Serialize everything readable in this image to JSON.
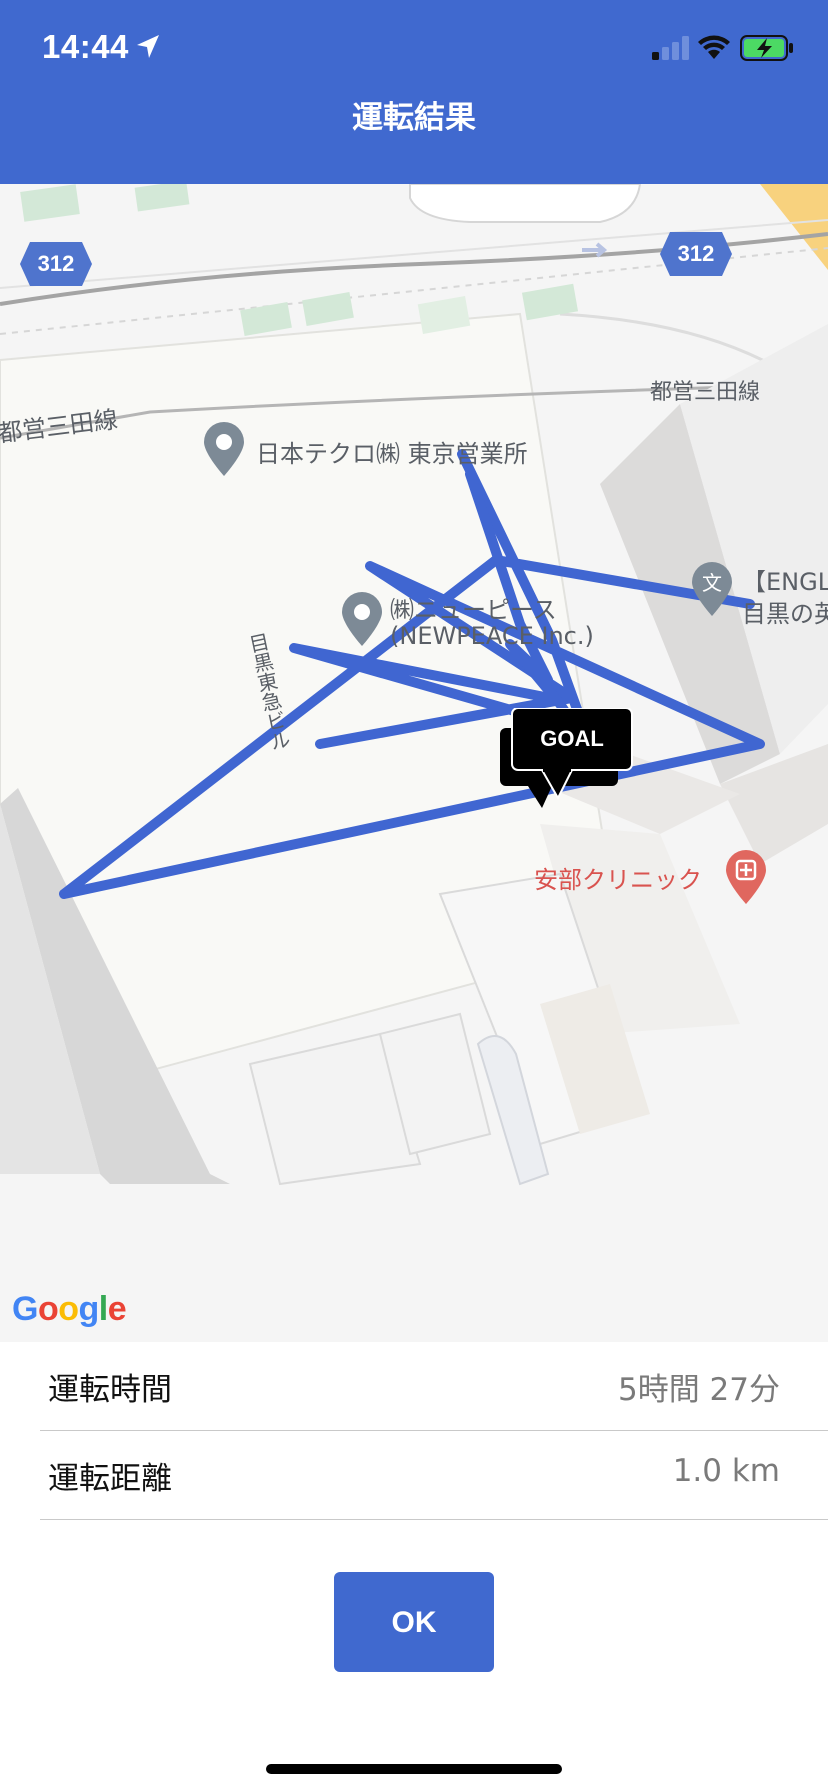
{
  "status_bar": {
    "time": "14:44",
    "icons": [
      "location-arrow-icon",
      "cellular-signal-icon",
      "wifi-icon",
      "battery-charging-icon"
    ]
  },
  "header": {
    "title": "運転結果"
  },
  "map": {
    "road_signs": [
      "312",
      "312"
    ],
    "labels": {
      "line_left": "都営三田線",
      "line_right": "都営三田線",
      "poi1": "日本テクロ㈱ 東京営業所",
      "poi2_line1": "㈱ニューピース",
      "poi2_line2": "(NEWPEACE Inc.)",
      "poi3_line1": "【ENGL",
      "poi3_line2": "目黒の英",
      "building": "目黒東急ビル",
      "clinic": "安部クリニック"
    },
    "goal_marker": "GOAL",
    "attribution": "Google",
    "route_color": "#4066d1"
  },
  "results": {
    "time_label": "運転時間",
    "time_value": "5時間 27分",
    "distance_label": "運転距離",
    "distance_value": "1.0 km"
  },
  "ok_button": "OK",
  "colors": {
    "accent": "#4069cf",
    "clinic": "#e0675f",
    "pin": "#7d8a96"
  }
}
